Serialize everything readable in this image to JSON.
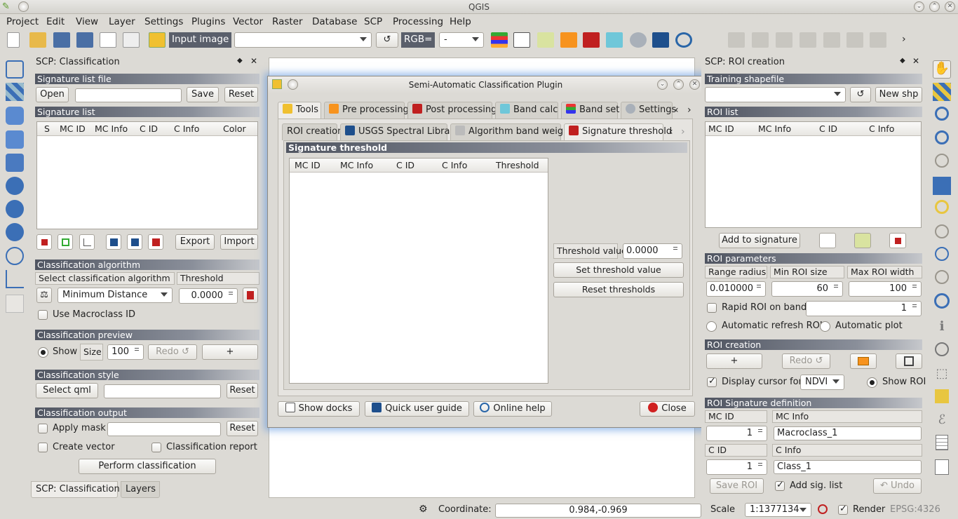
{
  "window": {
    "title": "QGIS"
  },
  "menu": [
    "Project",
    "Edit",
    "View",
    "Layer",
    "Settings",
    "Plugins",
    "Vector",
    "Raster",
    "Database",
    "SCP",
    "Processing",
    "Help"
  ],
  "toolbar": {
    "input_image_label": "Input image",
    "input_image_value": "",
    "refresh": "↺",
    "rgb_label": "RGB=",
    "rgb_value": "-"
  },
  "left_panel": {
    "title": "SCP: Classification",
    "signature_list_file": "Signature list file",
    "open": "Open",
    "save": "Save",
    "reset": "Reset",
    "signature_list": "Signature list",
    "columns": [
      "S",
      "MC ID",
      "MC Info",
      "C ID",
      "C Info",
      "Color"
    ],
    "export": "Export",
    "import": "Import",
    "classification_algorithm": "Classification algorithm",
    "select_algorithm": "Select classification algorithm",
    "threshold": "Threshold",
    "algorithm_value": "Minimum Distance",
    "threshold_value": "0.0000",
    "use_macroclass": "Use Macroclass ID",
    "classification_preview": "Classification preview",
    "show": "Show",
    "size": "Size",
    "size_value": "100",
    "redo": "Redo ↺",
    "plus": "+",
    "classification_style": "Classification style",
    "select_qml": "Select qml",
    "reset2": "Reset",
    "classification_output": "Classification output",
    "apply_mask": "Apply mask",
    "reset3": "Reset",
    "create_vector": "Create vector",
    "classification_report": "Classification report",
    "perform": "Perform classification",
    "tabs": [
      "SCP: Classification",
      "Layers"
    ]
  },
  "dialog": {
    "title": "Semi-Automatic Classification Plugin",
    "tabs1": [
      "Tools",
      "Pre processing",
      "Post processing",
      "Band calc",
      "Band set",
      "Settings"
    ],
    "tabs2": [
      "ROI creation",
      "USGS Spectral Library",
      "Algorithm band weight",
      "Signature threshold"
    ],
    "section": "Signature threshold",
    "columns": [
      "MC ID",
      "MC Info",
      "C ID",
      "C Info",
      "Threshold"
    ],
    "threshold_value_label": "Threshold value",
    "threshold_value": "0.0000",
    "set_threshold": "Set threshold value",
    "reset_thresholds": "Reset  thresholds",
    "show_docks": "Show docks",
    "quick_guide": "Quick user guide",
    "online_help": "Online help",
    "close": "Close"
  },
  "right_panel": {
    "title": "SCP: ROI creation",
    "training_shapefile": "Training shapefile",
    "refresh": "↺",
    "new_shp": "New shp",
    "roi_list": "ROI list",
    "columns": [
      "MC ID",
      "MC Info",
      "C ID",
      "C Info"
    ],
    "add_to_signature": "Add to signature",
    "roi_parameters": "ROI parameters",
    "range_radius": "Range radius",
    "min_roi_size": "Min ROI size",
    "max_roi_width": "Max ROI width",
    "range_value": "0.010000",
    "min_value": "60",
    "max_value": "100",
    "rapid_roi": "Rapid ROI on band",
    "rapid_value": "1",
    "auto_refresh": "Automatic refresh ROI",
    "auto_plot": "Automatic  plot",
    "roi_creation": "ROI creation",
    "plus": "+",
    "redo": "Redo ↺",
    "display_cursor": "Display cursor for",
    "cursor_value": "NDVI",
    "show_roi": "Show ROI",
    "roi_sig_def": "ROI Signature definition",
    "mc_id": "MC ID",
    "mc_info": "MC Info",
    "mc_id_value": "1",
    "mc_info_value": "Macroclass_1",
    "c_id": "C ID",
    "c_info": "C Info",
    "c_id_value": "1",
    "c_info_value": "Class_1",
    "save_roi": "Save ROI",
    "add_sig_list": "Add sig. list",
    "undo": "↶ Undo"
  },
  "status": {
    "coordinate_label": "Coordinate:",
    "coordinate": "0.984,-0.969",
    "scale_label": "Scale",
    "scale": "1:1377134",
    "render": "Render",
    "epsg": "EPSG:4326"
  }
}
